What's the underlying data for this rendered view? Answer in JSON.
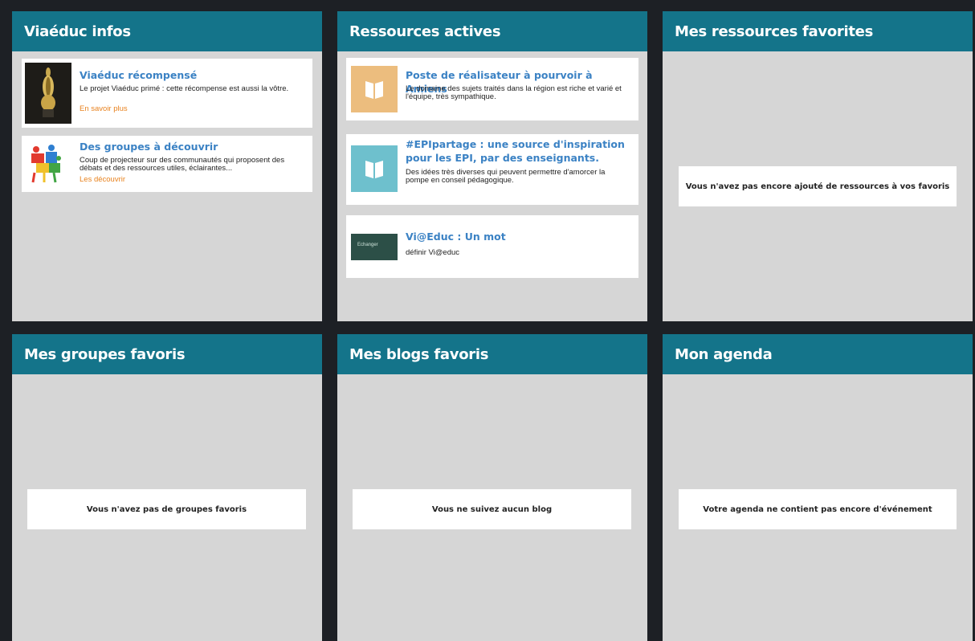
{
  "panels": {
    "infos": {
      "title": "Viaéduc infos",
      "items": [
        {
          "title": "Viaéduc récompensé",
          "description": "Le projet Viaéduc primé : cette récompense est aussi la vôtre.",
          "link": "En savoir plus"
        },
        {
          "title": "Des groupes à découvrir",
          "description": "Coup de projecteur sur des communautés qui proposent des débats et des ressources utiles, éclairantes...",
          "link": "Les découvrir"
        }
      ]
    },
    "resources": {
      "title": "Ressources actives",
      "items": [
        {
          "title": "Poste de réalisateur à pourvoir à Amiens",
          "description": "Le domaine des sujets traités dans la région est riche et varié et l'équipe, très sympathique.",
          "icon": "open-book-icon",
          "color": "#ecbd7e"
        },
        {
          "title": "#EPIpartage : une source d'inspiration pour les EPI, par des enseignants.",
          "description": "Des idées très diverses qui peuvent permettre d'amorcer la pompe en conseil pédagogique.",
          "icon": "open-book-icon",
          "color": "#6ec0cd"
        },
        {
          "title": "Vi@Educ : Un mot",
          "description": "définir Vi@educ",
          "thumb_text": "Echanger"
        }
      ]
    },
    "fav_resources": {
      "title": "Mes ressources favorites",
      "empty": "Vous n'avez pas encore ajouté de ressources à vos favoris"
    },
    "fav_groups": {
      "title": "Mes groupes favoris",
      "empty": "Vous n'avez pas de groupes favoris"
    },
    "fav_blogs": {
      "title": "Mes blogs favoris",
      "empty": "Vous ne suivez aucun blog"
    },
    "agenda": {
      "title": "Mon agenda",
      "empty": "Votre agenda ne contient pas encore d'événement"
    }
  },
  "colors": {
    "background": "#1d2025",
    "header": "#14748a",
    "panel": "#d6d6d6",
    "link_title": "#3b82c4",
    "link_more": "#e8821e"
  }
}
